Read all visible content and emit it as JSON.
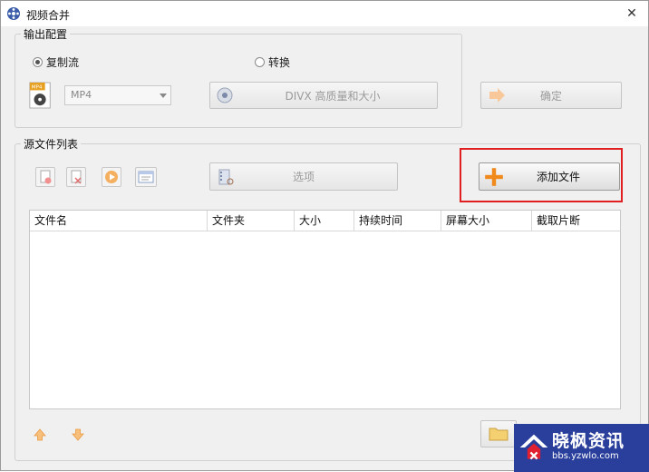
{
  "window": {
    "title": "视频合并"
  },
  "output_config": {
    "label": "输出配置",
    "mode_copy": "复制流",
    "mode_convert": "转换",
    "format": "MP4",
    "preset_label": "DIVX 高质量和大小",
    "confirm_label": "确定"
  },
  "source_list": {
    "label": "源文件列表",
    "options_label": "选项",
    "add_file_label": "添加文件",
    "columns": [
      "文件名",
      "文件夹",
      "大小",
      "持续时间",
      "屏幕大小",
      "截取片断"
    ]
  },
  "watermark": {
    "text": "晓枫资讯",
    "url": "bbs.yzwlo.com"
  },
  "colors": {
    "highlight": "#e02020",
    "accent_orange": "#f08a1c"
  }
}
